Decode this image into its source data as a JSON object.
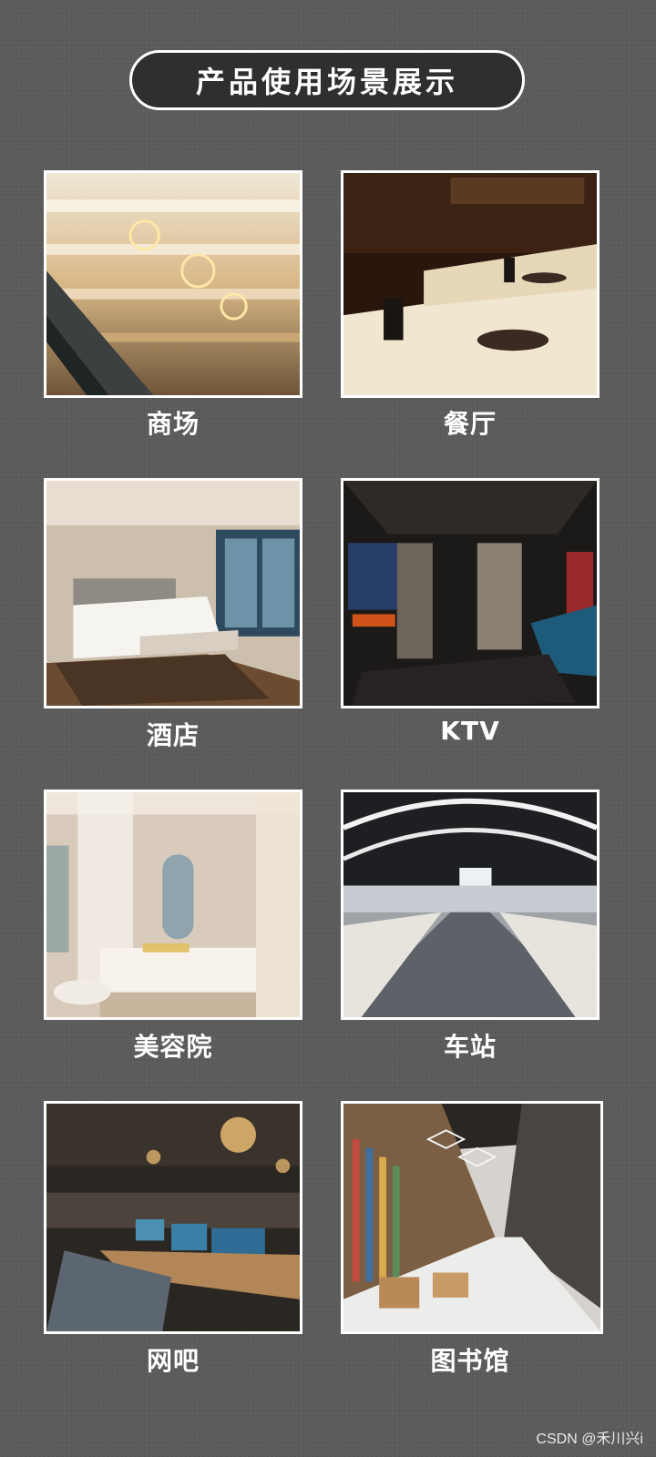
{
  "title": "产品使用场景展示",
  "scenes": [
    {
      "label": "商场",
      "image": "shopping-mall-photo"
    },
    {
      "label": "餐厅",
      "image": "restaurant-photo"
    },
    {
      "label": "酒店",
      "image": "hotel-room-photo"
    },
    {
      "label": "KTV",
      "image": "ktv-room-photo"
    },
    {
      "label": "美容院",
      "image": "beauty-salon-photo"
    },
    {
      "label": "车站",
      "image": "station-hall-photo"
    },
    {
      "label": "网吧",
      "image": "internet-cafe-photo"
    },
    {
      "label": "图书馆",
      "image": "library-photo"
    }
  ],
  "watermark": "CSDN @禾川兴i"
}
